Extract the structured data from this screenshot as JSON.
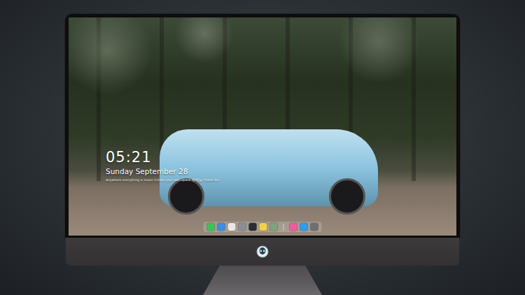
{
  "clock": {
    "time": "05:21",
    "date": "Sunday September 28",
    "caption": "Anywhere everything is music   Create your own space   방하늘   Thank You"
  },
  "dock": {
    "items": [
      {
        "color": "#3cc25a"
      },
      {
        "color": "#3a8ee8"
      },
      {
        "color": "#e8e8e8"
      },
      {
        "color": "#8a8f96"
      },
      {
        "color": "#2a2d33"
      },
      {
        "color": "#f2d04a"
      },
      {
        "color": "#7fa37a"
      },
      {
        "color": "#f05aa0"
      },
      {
        "color": "#2d9cf0"
      },
      {
        "color": "#6d6f73"
      }
    ],
    "separator_after": 7
  }
}
